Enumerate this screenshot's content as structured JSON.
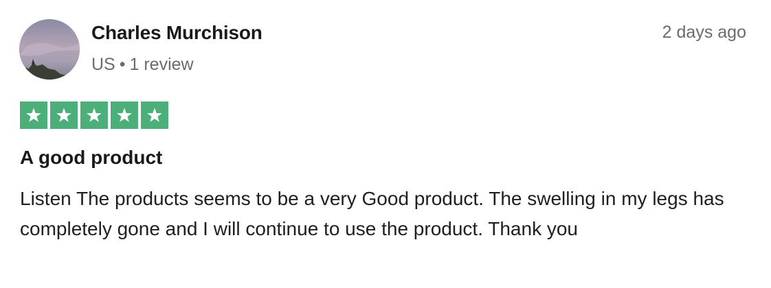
{
  "reviewer": {
    "name": "Charles Murchison",
    "country": "US",
    "separator": "•",
    "review_count": "1 review",
    "avatar_icon": "profile-photo"
  },
  "review": {
    "date": "2 days ago",
    "rating": 5,
    "max_rating": 5,
    "title": "A good product",
    "body": "Listen The products seems to be a very Good product. The swelling in my legs has completely gone and I will continue to use the product. Thank you"
  },
  "colors": {
    "star_background": "#4caf7a",
    "star": "#ffffff",
    "meta_text": "#6b6b6b"
  }
}
